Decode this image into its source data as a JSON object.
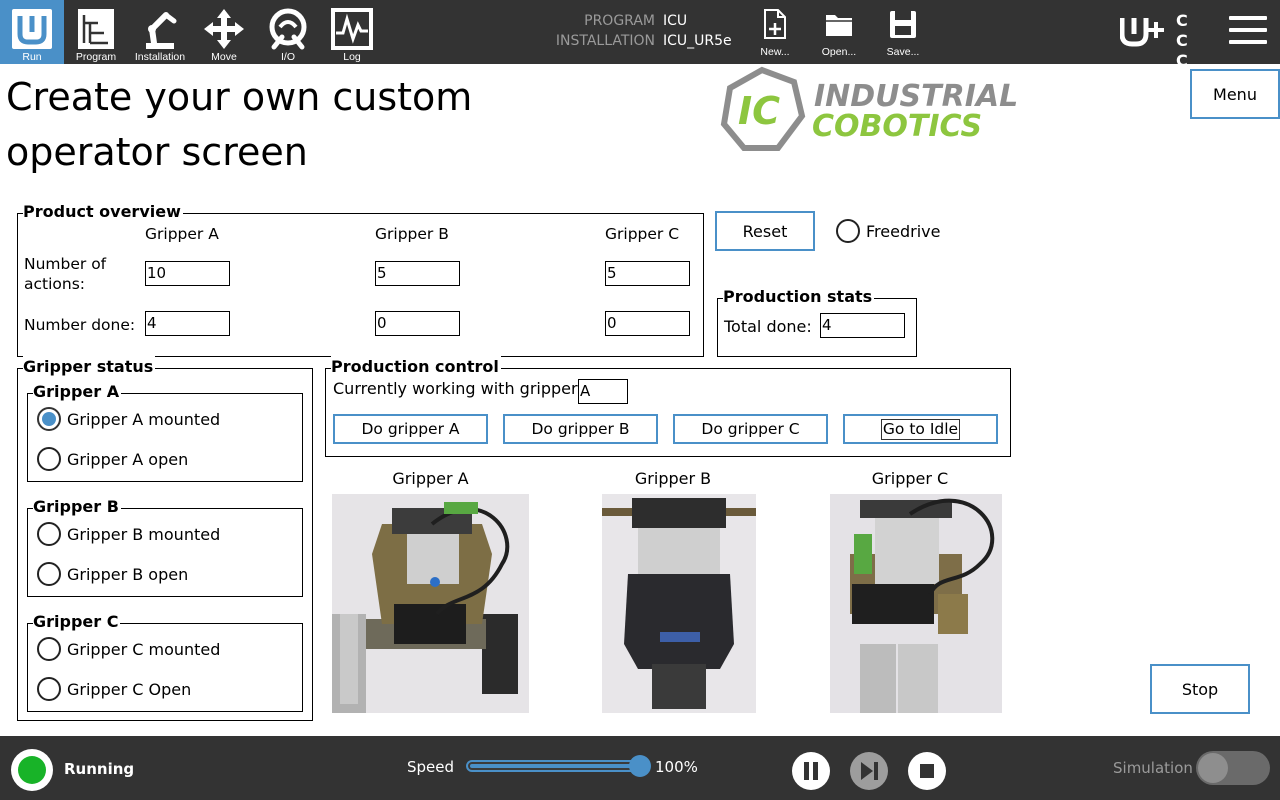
{
  "topbar": {
    "tabs": [
      {
        "label": "Run",
        "icon": "ur-logo-icon",
        "active": true
      },
      {
        "label": "Program",
        "icon": "program-tree-icon"
      },
      {
        "label": "Installation",
        "icon": "robot-arm-icon"
      },
      {
        "label": "Move",
        "icon": "move-arrows-icon"
      },
      {
        "label": "I/O",
        "icon": "io-ring-icon"
      },
      {
        "label": "Log",
        "icon": "log-graph-icon"
      }
    ],
    "program_key": "PROGRAM",
    "program_value": "ICU",
    "installation_key": "INSTALLATION",
    "installation_value": "ICU_UR5e",
    "file_buttons": [
      {
        "label": "New...",
        "icon": "new-file-icon"
      },
      {
        "label": "Open...",
        "icon": "folder-icon"
      },
      {
        "label": "Save...",
        "icon": "save-disk-icon"
      }
    ],
    "cc_marks": "C C C C"
  },
  "main": {
    "title_line1": "Create your own custom",
    "title_line2": "operator screen",
    "logo": {
      "mark": "IC",
      "word1": "INDUSTRIAL",
      "word2": "COBOTICS",
      "colors": {
        "grey": "#8d8d8d",
        "green": "#8dc63f"
      }
    },
    "menu_label": "Menu",
    "product_overview": {
      "legend": "Product overview",
      "columns": [
        "Gripper A",
        "Gripper B",
        "Gripper C"
      ],
      "row1_label": "Number of actions:",
      "row1_values": [
        "10",
        "5",
        "5"
      ],
      "row2_label": "Number done:",
      "row2_values": [
        "4",
        "0",
        "0"
      ]
    },
    "reset_label": "Reset",
    "freedrive_label": "Freedrive",
    "production_stats": {
      "legend": "Production stats",
      "total_label": "Total done:",
      "total_value": "4"
    },
    "gripper_status": {
      "legend": "Gripper status",
      "groups": [
        {
          "title": "Gripper A",
          "options": [
            {
              "label": "Gripper A mounted",
              "checked": true
            },
            {
              "label": "Gripper A open",
              "checked": false
            }
          ]
        },
        {
          "title": "Gripper B",
          "options": [
            {
              "label": "Gripper B mounted",
              "checked": false
            },
            {
              "label": "Gripper B open",
              "checked": false
            }
          ]
        },
        {
          "title": "Gripper C",
          "options": [
            {
              "label": "Gripper C mounted",
              "checked": false
            },
            {
              "label": "Gripper C Open",
              "checked": false
            }
          ]
        }
      ]
    },
    "production_control": {
      "legend": "Production control",
      "working_label": "Currently working with gripper",
      "working_value": "A",
      "buttons": [
        "Do gripper A",
        "Do gripper B",
        "Do gripper C",
        "Go to Idle"
      ]
    },
    "photos": [
      "Gripper A",
      "Gripper B",
      "Gripper C"
    ],
    "stop_label": "Stop"
  },
  "bottombar": {
    "status": "Running",
    "status_color": "#18b328",
    "speed_label": "Speed",
    "speed_value": "100%",
    "speed_fraction": 1.0,
    "simulation_label": "Simulation",
    "accent": "#4a90c8"
  }
}
